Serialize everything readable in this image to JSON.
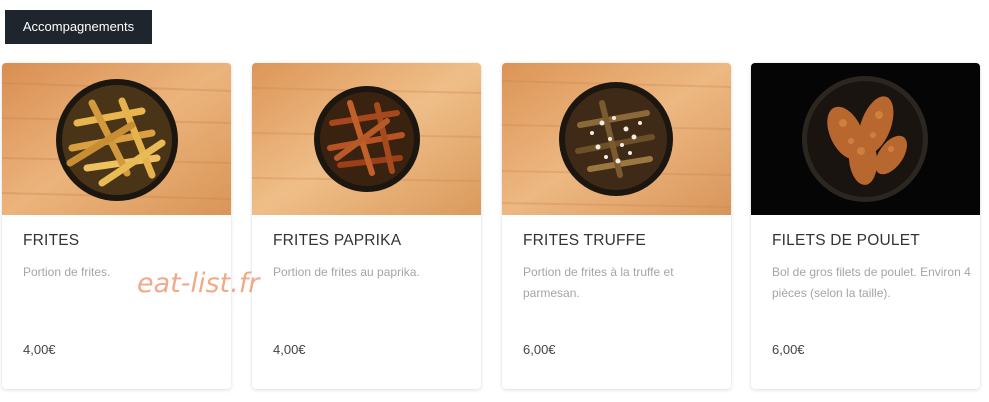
{
  "category_tab": {
    "label": "Accompagnements"
  },
  "items": [
    {
      "title": "FRITES",
      "description": "Portion de frites.",
      "price": "4,00€",
      "image": "fries-bowl-image"
    },
    {
      "title": "FRITES PAPRIKA",
      "description": "Portion de frites au paprika.",
      "price": "4,00€",
      "image": "paprika-fries-bowl-image"
    },
    {
      "title": "FRITES TRUFFE",
      "description": "Portion de frites à la truffe et parmesan.",
      "price": "6,00€",
      "image": "truffle-fries-bowl-image"
    },
    {
      "title": "FILETS DE POULET",
      "description": "Bol de gros filets de poulet. Environ 4 pièces (selon la taille).",
      "price": "6,00€",
      "image": "chicken-tenders-bowl-image"
    }
  ],
  "watermark": "eat-list.fr",
  "colors": {
    "tab_background": "#1f252d",
    "wood_background": "#e2a468",
    "dark_background": "#050505",
    "title_text": "#333333",
    "description_text": "#a5a5a5",
    "watermark": "#f0a07c"
  }
}
